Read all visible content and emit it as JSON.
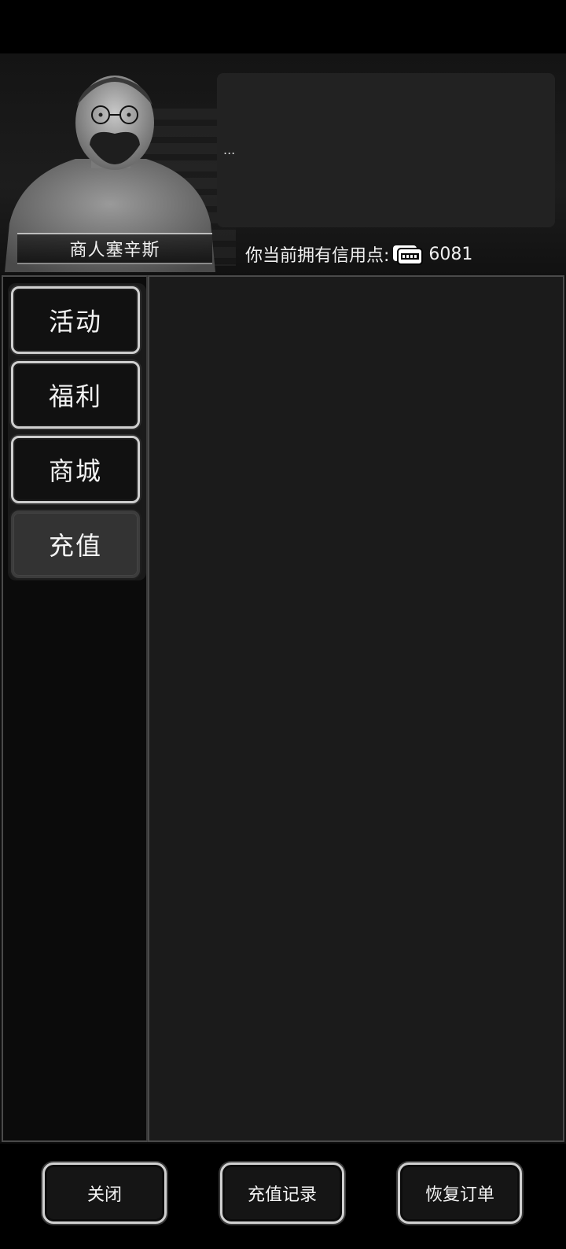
{
  "header": {
    "merchant_name": "商人塞辛斯",
    "dialog_text": "...",
    "credits_label": "你当前拥有信用点:",
    "credits_value": "6081",
    "credit_icon": "credit-card-icon"
  },
  "sidebar": {
    "tabs": [
      {
        "label": "活动",
        "active": false
      },
      {
        "label": "福利",
        "active": false
      },
      {
        "label": "商城",
        "active": false
      },
      {
        "label": "充值",
        "active": true
      }
    ]
  },
  "footer": {
    "close_label": "关闭",
    "recharge_history_label": "充值记录",
    "restore_order_label": "恢复订单"
  }
}
